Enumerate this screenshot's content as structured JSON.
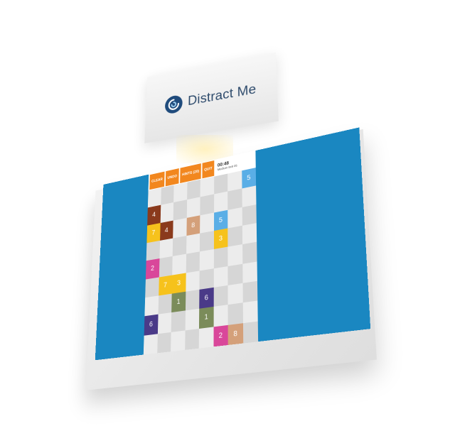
{
  "brand": {
    "name": "Distract Me",
    "logo_icon": "swirl-logo-icon"
  },
  "toolbar": {
    "buttons": [
      {
        "label": "CLEAR"
      },
      {
        "label": "UNDO"
      },
      {
        "label": "HINTS (20)"
      },
      {
        "label": "QUIT"
      }
    ],
    "timer": "00:48",
    "mode": "Medium 8x8 05"
  },
  "colors": {
    "accent_orange": "#f2871e",
    "background_blue": "#1a87c1",
    "tile_brown": "#8a3a1c",
    "tile_yellow": "#f6c21c",
    "tile_tan": "#d4a07a",
    "tile_lightblue": "#5aaee6",
    "tile_pink": "#d9479a",
    "tile_olive": "#7b8c5a",
    "tile_purple": "#4a3a88"
  },
  "board": {
    "rows": 8,
    "cols": 8,
    "tiles": [
      {
        "row": 0,
        "col": 7,
        "value": "5",
        "color": "#5aaee6"
      },
      {
        "row": 1,
        "col": 0,
        "value": "4",
        "color": "#8a3a1c"
      },
      {
        "row": 2,
        "col": 0,
        "value": "7",
        "color": "#f6c21c"
      },
      {
        "row": 2,
        "col": 1,
        "value": "4",
        "color": "#8a3a1c"
      },
      {
        "row": 2,
        "col": 3,
        "value": "8",
        "color": "#d4a07a"
      },
      {
        "row": 2,
        "col": 5,
        "value": "5",
        "color": "#5aaee6"
      },
      {
        "row": 3,
        "col": 5,
        "value": "3",
        "color": "#f6c21c"
      },
      {
        "row": 4,
        "col": 0,
        "value": "2",
        "color": "#d9479a"
      },
      {
        "row": 5,
        "col": 1,
        "value": "7",
        "color": "#f6c21c"
      },
      {
        "row": 5,
        "col": 2,
        "value": "3",
        "color": "#f6c21c"
      },
      {
        "row": 6,
        "col": 2,
        "value": "1",
        "color": "#7b8c5a"
      },
      {
        "row": 6,
        "col": 4,
        "value": "6",
        "color": "#4a3a88"
      },
      {
        "row": 7,
        "col": 0,
        "value": "6",
        "color": "#4a3a88"
      },
      {
        "row": 7,
        "col": 4,
        "value": "1",
        "color": "#7b8c5a"
      },
      {
        "row": 8,
        "col": 5,
        "value": "2",
        "color": "#d9479a"
      },
      {
        "row": 8,
        "col": 6,
        "value": "8",
        "color": "#d4a07a"
      }
    ]
  }
}
